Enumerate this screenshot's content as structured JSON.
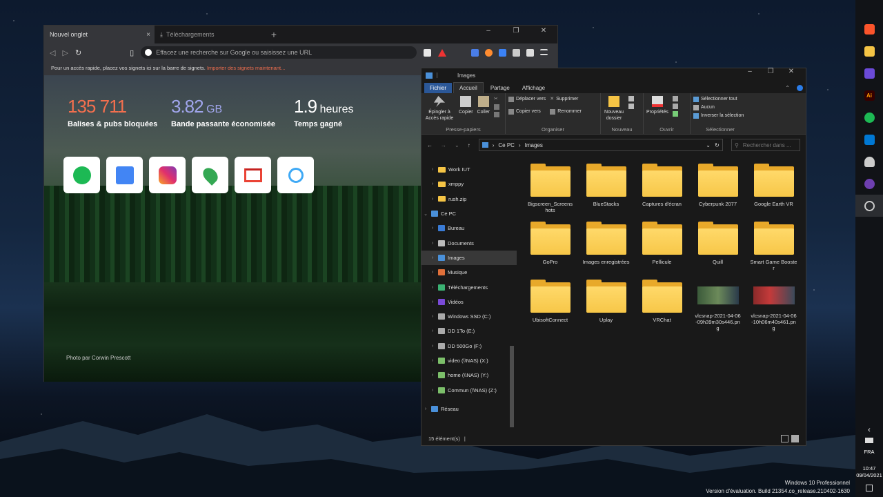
{
  "browser": {
    "tabs": [
      {
        "label": "Nouvel onglet",
        "close": "×"
      },
      {
        "label": "Téléchargements"
      }
    ],
    "new_tab": "+",
    "window_controls": [
      "–",
      "❐",
      "✕"
    ],
    "address_placeholder": "Effacez une recherche sur Google ou saisissez une URL",
    "bookmarks_bar": {
      "text": "Pour un accès rapide, placez vos signets ici sur la barre de signets.",
      "link": "Importer des signets maintenant..."
    },
    "stats": [
      {
        "number": "135 711",
        "unit": "",
        "label": "Balises & pubs bloquées",
        "color": "#f36f4e"
      },
      {
        "number": "3.82",
        "unit": "GB",
        "label": "Bande passante économisée",
        "color": "#a0a5eb"
      },
      {
        "number": "1.9",
        "unit": "heures",
        "label": "Temps gagné",
        "color": "#ffffff"
      }
    ],
    "speed_dial": [
      "spotify-icon",
      "google-translate-icon",
      "instagram-icon",
      "google-maps-icon",
      "gmail-icon",
      "cortana-icon"
    ],
    "photo_credit": "Photo par Corwin Prescott",
    "colors": {
      "accent": "#f36f4e",
      "bg": "#202124"
    }
  },
  "explorer": {
    "title": "Images",
    "ribbon_tabs": [
      "Fichier",
      "Accueil",
      "Partage",
      "Affichage"
    ],
    "groups": {
      "presse": {
        "label": "Presse-papiers",
        "pin": "Épingler à Accès rapide",
        "copy": "Copier",
        "paste": "Coller"
      },
      "organiser": {
        "label": "Organiser",
        "move": "Déplacer vers",
        "copyto": "Copier vers",
        "delete": "Supprimer",
        "rename": "Renommer"
      },
      "nouveau": {
        "label": "Nouveau",
        "folder": "Nouveau dossier"
      },
      "ouvrir": {
        "label": "Ouvrir",
        "props": "Propriétés"
      },
      "selectionner": {
        "label": "Sélectionner",
        "all": "Sélectionner tout",
        "none": "Aucun",
        "invert": "Inverser la sélection"
      }
    },
    "path": [
      "Ce PC",
      "Images"
    ],
    "search_placeholder": "Rechercher dans ...",
    "nav": [
      {
        "label": "Work IUT",
        "icon": "folder"
      },
      {
        "label": "xmppy",
        "icon": "folder"
      },
      {
        "label": "rush.zip",
        "icon": "folder"
      },
      {
        "label": "Ce PC",
        "icon": "pc",
        "expanded": true
      },
      {
        "label": "Bureau",
        "icon": "desktop"
      },
      {
        "label": "Documents",
        "icon": "documents"
      },
      {
        "label": "Images",
        "icon": "pictures",
        "selected": true
      },
      {
        "label": "Musique",
        "icon": "music"
      },
      {
        "label": "Téléchargements",
        "icon": "downloads"
      },
      {
        "label": "Vidéos",
        "icon": "videos"
      },
      {
        "label": "Windows SSD (C:)",
        "icon": "drive"
      },
      {
        "label": "DD 1To (E:)",
        "icon": "drive"
      },
      {
        "label": "DD 500Go (F:)",
        "icon": "drive"
      },
      {
        "label": "video (\\\\NAS) (X:)",
        "icon": "netdrive"
      },
      {
        "label": "home (\\\\NAS) (Y:)",
        "icon": "netdrive"
      },
      {
        "label": "Commun (\\\\NAS) (Z:)",
        "icon": "netdrive"
      },
      {
        "label": "Réseau",
        "icon": "network"
      }
    ],
    "items": [
      {
        "label": "Bigscreen_Screenshots",
        "type": "folder"
      },
      {
        "label": "BlueStacks",
        "type": "folder"
      },
      {
        "label": "Captures d'écran",
        "type": "folder"
      },
      {
        "label": "Cyberpunk 2077",
        "type": "folder"
      },
      {
        "label": "Google Earth VR",
        "type": "folder"
      },
      {
        "label": "GoPro",
        "type": "folder"
      },
      {
        "label": "Images enregistrées",
        "type": "folder"
      },
      {
        "label": "Pellicule",
        "type": "folder"
      },
      {
        "label": "Quill",
        "type": "folder"
      },
      {
        "label": "Smart Game Booster",
        "type": "folder"
      },
      {
        "label": "UbisoftConnect",
        "type": "folder"
      },
      {
        "label": "Uplay",
        "type": "folder"
      },
      {
        "label": "VRChat",
        "type": "folder"
      },
      {
        "label": "vlcsnap-2021-04-06-09h39m30s446.png",
        "type": "image"
      },
      {
        "label": "vlcsnap-2021-04-06-10h06m40s461.png",
        "type": "image"
      }
    ],
    "status": "15 élément(s)"
  },
  "taskbar": {
    "apps": [
      "brave-icon",
      "file-explorer-icon",
      "screen-recorder-icon",
      "illustrator-icon",
      "spotify-icon",
      "vscode-icon",
      "steam-vr-icon",
      "obs-icon",
      "settings-icon"
    ],
    "illustrator_text": "Ai",
    "lang": "FRA",
    "time": "10:47",
    "date": "09/04/2021"
  },
  "watermark": {
    "line1": "Windows 10 Professionnel",
    "line2": "Version d'évaluation. Build 21354.co_release.210402-1630"
  }
}
